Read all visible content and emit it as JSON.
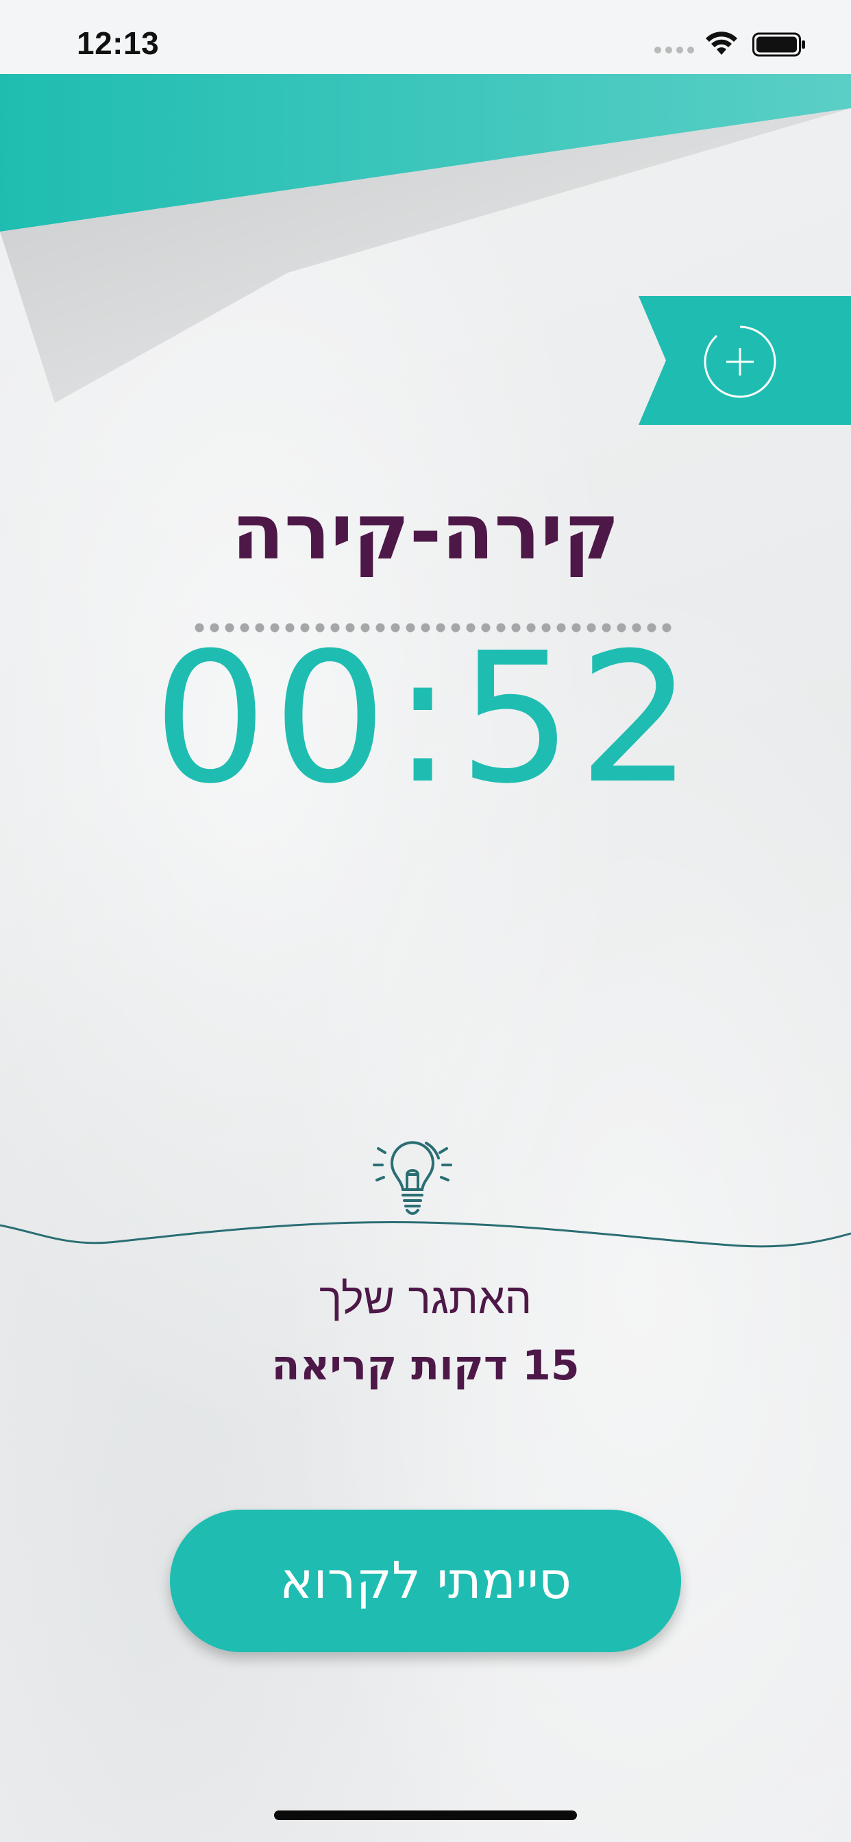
{
  "status_bar": {
    "time": "12:13"
  },
  "header": {
    "title": "קירה-קירה"
  },
  "timer": {
    "value": "00:52"
  },
  "challenge": {
    "label": "האתגר שלך",
    "value": "15 דקות קריאה"
  },
  "actions": {
    "done_label": "סיימתי לקרוא",
    "add_icon": "plus-circle-icon"
  },
  "icons": {
    "tip": "lightbulb-icon",
    "signal": "signal-dots-icon",
    "wifi": "wifi-icon",
    "battery": "battery-icon"
  },
  "colors": {
    "accent": "#1fbdb1",
    "title": "#4d1848",
    "background": "#eceeef",
    "wave": "#2a6e73"
  }
}
